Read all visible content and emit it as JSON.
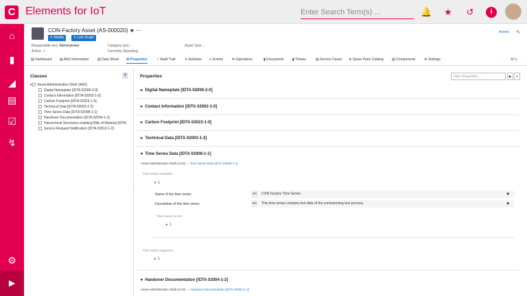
{
  "app": {
    "title": "Elements for IoT",
    "logo": "C"
  },
  "search": {
    "placeholder": "Enter Search Term(s) ..."
  },
  "asset": {
    "title": "CON-Factory Asset (AS-000020)",
    "modify": "Modify",
    "link_graph": "Link Graph",
    "responsible_label": "Responsible (en):",
    "responsible_value": "Administrator",
    "active_label": "Active:",
    "active_value": "✓",
    "category_label": "Category (en):",
    "category_value": "-",
    "currently_operating_label": "Currently Operating:",
    "asset_type_label": "Asset Type:",
    "asset_type_value": "-",
    "assets_link": "Assets"
  },
  "tabs": [
    "Dashboard",
    "AAS Information",
    "Data Sheet",
    "Properties",
    "Audit Trail",
    "Activities",
    "Events",
    "Operations",
    "Documents",
    "Tickets",
    "Service Cases",
    "Spare Parts Catalog",
    "Components",
    "Settings"
  ],
  "tabs_all": "All",
  "classes": {
    "title": "Classes",
    "root": "Asset Administration Shell (AAS)",
    "items": [
      "Digital Nameplate [IDTA 02006-2-0]",
      "Contact Information [IDTA 02002-1-0]",
      "Carbon Footprint [IDTA 02023-1-0]",
      "Technical Data [IDTA 02003-1-2]",
      "Time Series Data [IDTA 02008-1-1]",
      "Handover Documentation [IDTA 02004-1-2]",
      "Hierarchical Structures enabling Bills of Material [IDTA",
      "Service Request Notification [IDTA 02010-1-0]"
    ]
  },
  "properties": {
    "title": "Properties",
    "filter_placeholder": "Filter Properties ...",
    "sections": [
      "Digital Nameplate [IDTA 02006-2-0]",
      "Contact Information [IDTA 02002-1-0]",
      "Carbon Footprint [IDTA 02023-1-0]",
      "Technical Data [IDTA 02003-1-2]",
      "Time Series Data [IDTA 02008-1-1]",
      "Handover Documentation [IDTA 02004-1-2]"
    ],
    "ts_crumb_1": "Asset Administration Shell (AAS)",
    "ts_crumb_2": "Time Series Data [IDTA 02008-1-1]",
    "ts_metadata": "Time series metadata",
    "ts_index": "1",
    "name_label": "Name of the time series",
    "name_lang": "en",
    "name_value": "CON Factory Time Series",
    "desc_label": "Description of the time series",
    "desc_lang": "en",
    "desc_value": "This time series contains test data of the comissioning test process.",
    "ts_record": "Time series record",
    "record_index": "1",
    "ts_segments": "Time series segments",
    "segments_index": "1",
    "ho_crumb_1": "Asset Administration Shell (AAS)",
    "ho_crumb_2": "Handover Documentation [IDTA 02004-1-2]"
  },
  "colors": {
    "brand": "#e0004f",
    "link": "#1a73c9"
  },
  "icons": [
    "bell-icon",
    "star-icon",
    "history-icon",
    "info-icon",
    "home-icon",
    "document-icon",
    "hierarchy-icon",
    "card-icon",
    "checklist-icon",
    "pulse-icon",
    "gear-icon",
    "chevron-right-icon",
    "globe-icon"
  ]
}
